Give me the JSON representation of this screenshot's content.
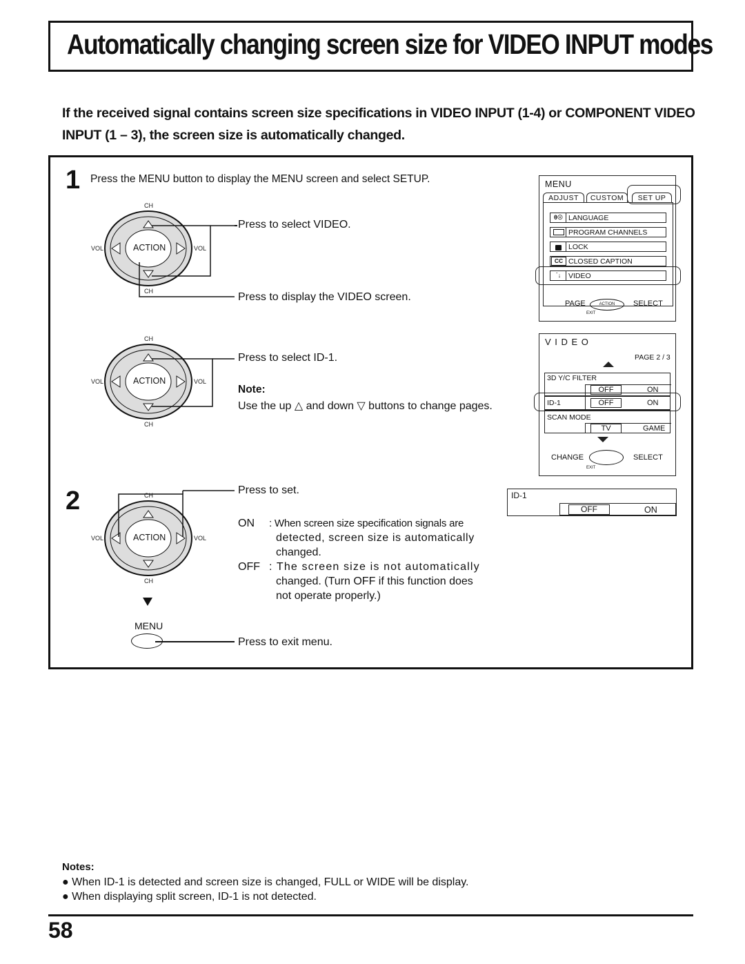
{
  "title": "Automatically changing screen size for VIDEO INPUT modes",
  "intro": "If the received signal contains screen size specifications in VIDEO INPUT  (1-4) or COMPONENT VIDEO INPUT (1 – 3), the screen size is automatically changed.",
  "step1": {
    "number": "1",
    "instruction": "Press the MENU button to display the MENU screen and select SETUP.",
    "callouts": {
      "select_video": "Press to select VIDEO.",
      "display_video": "Press to display the VIDEO screen.",
      "select_id1": "Press to select  ID-1.",
      "note_title": "Note:",
      "note_text": "Use the up △ and down ▽ buttons to change pages."
    }
  },
  "step2": {
    "number": "2",
    "callouts": {
      "press_set": "Press to set.",
      "on_label": "ON",
      "on_text_1": ": When screen size specification signals are",
      "on_text_2": "detected, screen size is automatically",
      "on_text_3": "changed.",
      "off_label": "OFF",
      "off_text_1": ": The screen size is not automatically",
      "off_text_2": "changed. (Turn OFF if this function does",
      "off_text_3": "not operate properly.)",
      "exit": "Press to exit menu."
    },
    "menu_button_label": "MENU"
  },
  "remote": {
    "ch": "CH",
    "vol": "VOL",
    "action": "ACTION"
  },
  "menu_screen": {
    "title": "MENU",
    "tabs": [
      "ADJUST",
      "CUSTOM",
      "SET  UP"
    ],
    "items": [
      {
        "icon": "language-icon",
        "glyph": "θ☉",
        "label": "LANGUAGE"
      },
      {
        "icon": "program-channels-icon",
        "glyph": "",
        "label": "PROGRAM  CHANNELS"
      },
      {
        "icon": "lock-icon",
        "glyph": "🔒",
        "label": "LOCK"
      },
      {
        "icon": "closed-caption-icon",
        "glyph": "CC",
        "label": "CLOSED  CAPTION"
      },
      {
        "icon": "video-icon",
        "glyph": "˙↓",
        "label": "VIDEO"
      }
    ],
    "footer_left": "PAGE",
    "footer_right": "SELECT",
    "footer_action": "ACTION",
    "exit": "EXIT"
  },
  "video_screen": {
    "title": "V I D E O",
    "page": "PAGE 2 / 3",
    "rows": [
      {
        "label": "3D Y/C FILTER",
        "options": [
          "OFF",
          "ON"
        ],
        "selected": "OFF"
      },
      {
        "label": "ID-1",
        "options": [
          "OFF",
          "ON"
        ],
        "selected": "OFF"
      },
      {
        "label": "SCAN  MODE",
        "options": [
          "TV",
          "GAME"
        ],
        "selected": "TV"
      }
    ],
    "footer_left": "CHANGE",
    "footer_right": "SELECT",
    "exit": "EXIT"
  },
  "id1_bar": {
    "label": "ID-1",
    "options": [
      "OFF",
      "ON"
    ],
    "selected": "OFF"
  },
  "notes": {
    "title": "Notes:",
    "items": [
      "When ID-1 is detected and screen size is changed, FULL or WIDE will be display.",
      "When displaying split screen, ID-1 is not detected."
    ]
  },
  "page_number": "58"
}
